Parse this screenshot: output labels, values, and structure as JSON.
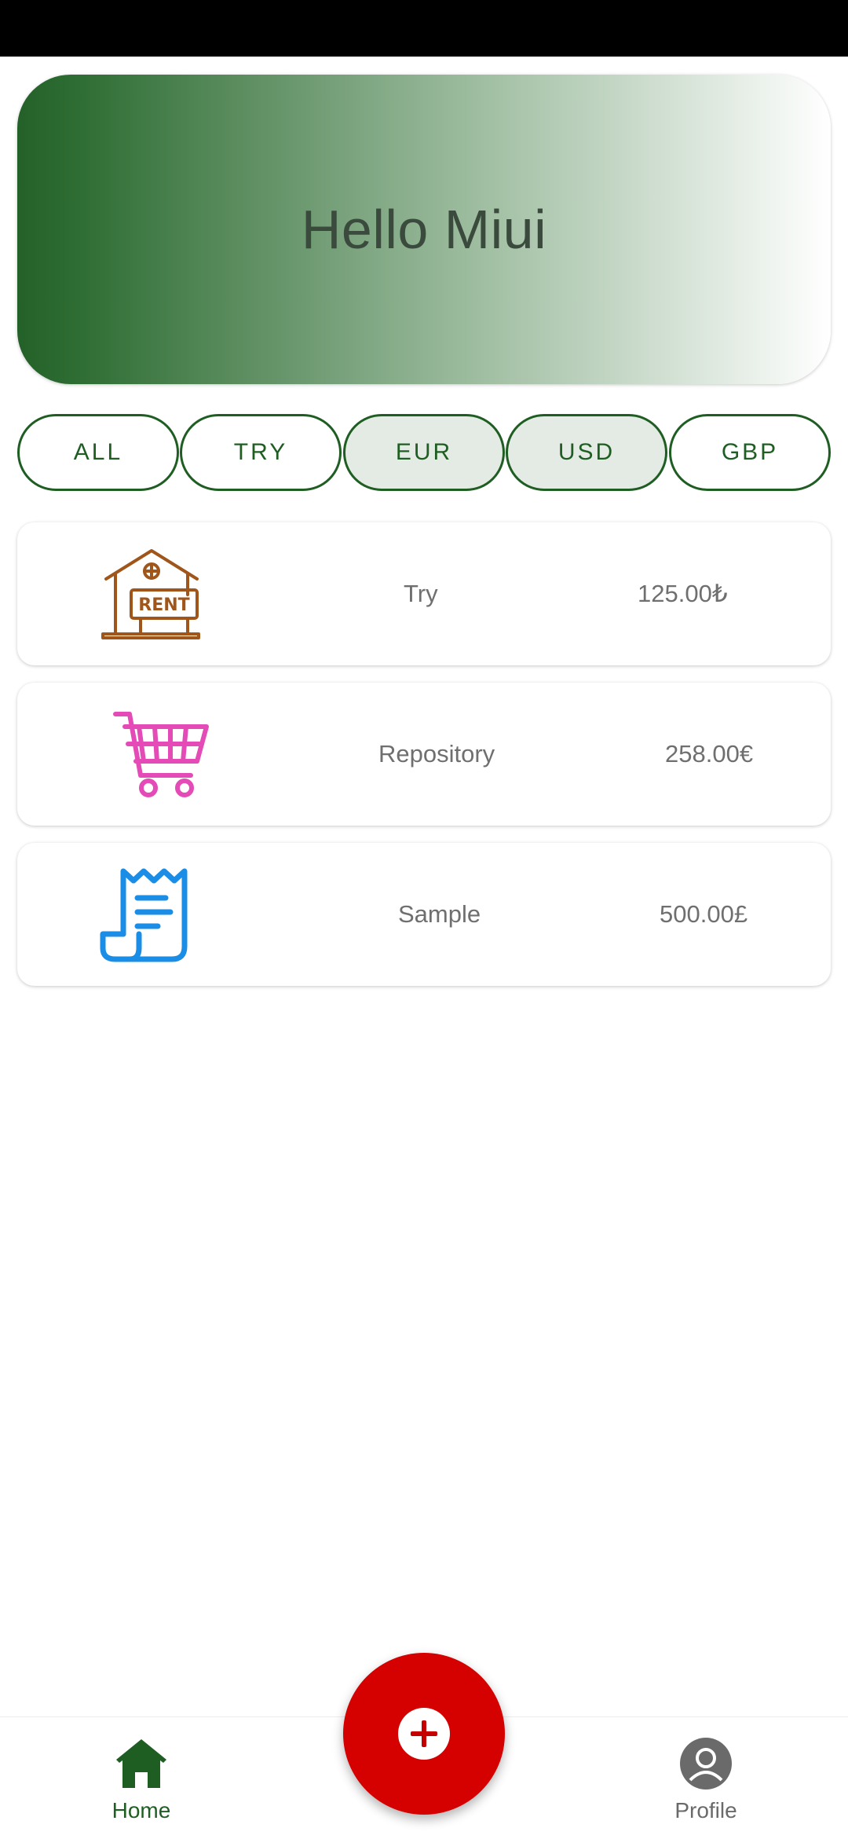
{
  "banner": {
    "greeting": "Hello Miui"
  },
  "filters": {
    "chips": [
      {
        "label": "ALL",
        "selected": false
      },
      {
        "label": "TRY",
        "selected": false
      },
      {
        "label": "EUR",
        "selected": true
      },
      {
        "label": "USD",
        "selected": true
      },
      {
        "label": "GBP",
        "selected": false
      }
    ]
  },
  "transactions": [
    {
      "icon": "rent-house-icon",
      "icon_badge": "RENT",
      "name": "Try",
      "amount": "125.00₺",
      "icon_color": "#a0561b"
    },
    {
      "icon": "shopping-cart-icon",
      "name": "Repository",
      "amount": "258.00€",
      "icon_color": "#e44bb6"
    },
    {
      "icon": "receipt-icon",
      "name": "Sample",
      "amount": "500.00£",
      "icon_color": "#1a8ee6"
    }
  ],
  "bottom_nav": {
    "items": [
      {
        "label": "Home",
        "icon": "home-icon",
        "active": true
      },
      {
        "label": "Profile",
        "icon": "profile-icon",
        "active": false
      }
    ],
    "fab_icon": "plus-icon"
  },
  "colors": {
    "primary": "#1f5e22",
    "fab": "#d50000",
    "text_muted": "#6f6f6f"
  }
}
